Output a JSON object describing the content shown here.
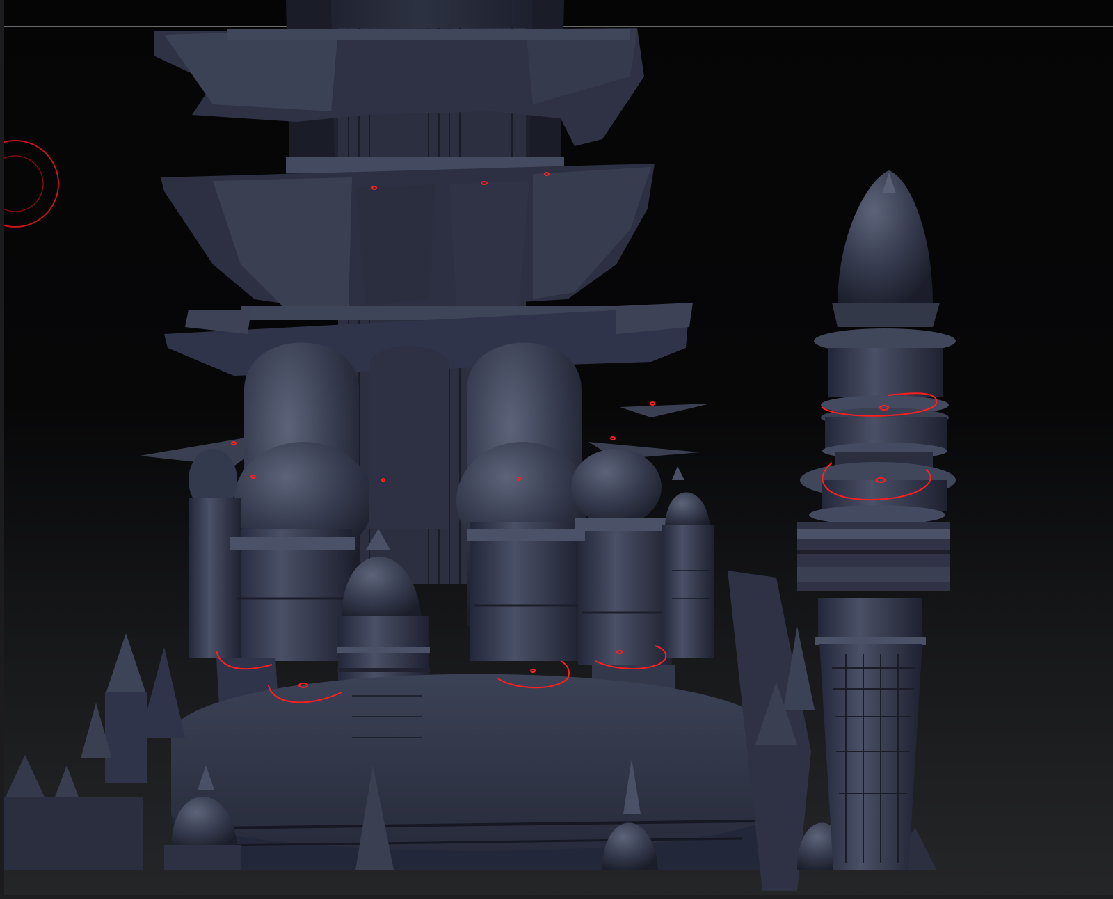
{
  "app": {
    "viewport": "3d-sculpt-viewport"
  },
  "model": {
    "material_color": "#3a3f52",
    "highlight_color": "#596078",
    "shadow_color": "#1a1d28",
    "mask_stroke_color": "#ff1f1f"
  },
  "cursor": {
    "brush_outer_color": "#c4141c",
    "brush_inner_color": "#7a0d10"
  },
  "frame": {
    "line_color": "#6b6b6e",
    "background_top": "#050506",
    "background_bottom": "#252628"
  }
}
